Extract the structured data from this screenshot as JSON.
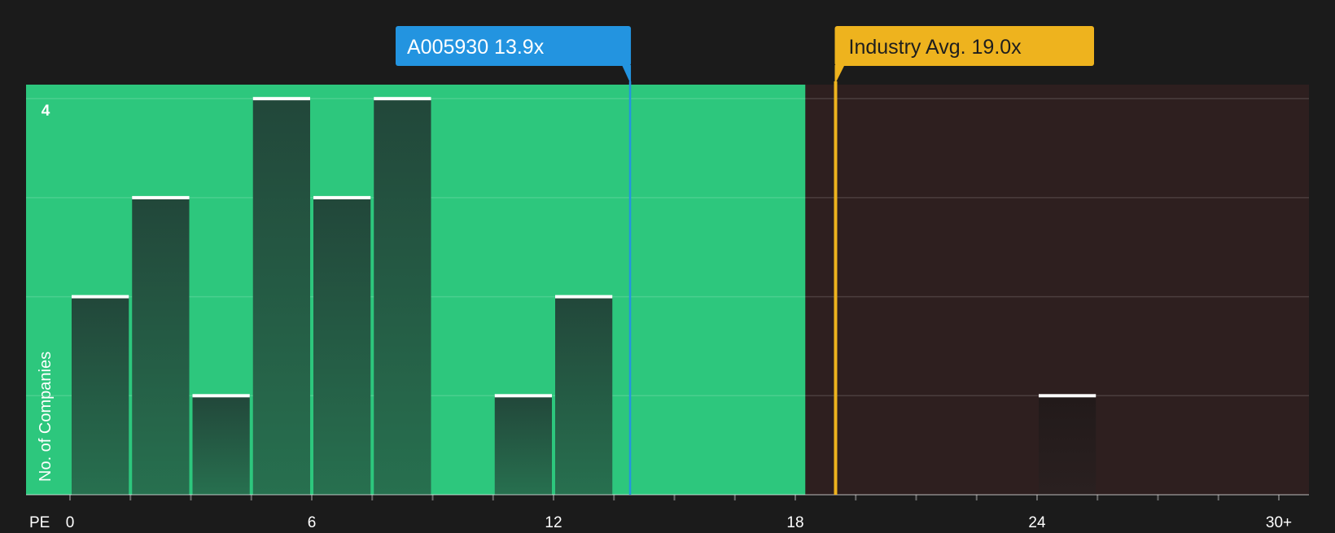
{
  "chart_data": {
    "type": "bar",
    "ylabel": "No. of Companies",
    "xlabel_prefix": "PE",
    "x_tick_labels": [
      "0",
      "6",
      "12",
      "18",
      "24",
      "30+"
    ],
    "y_tick_labels": [
      "4"
    ],
    "xlim": [
      0,
      30
    ],
    "ylim": [
      0,
      4
    ],
    "bins": [
      {
        "x0": 0,
        "x1": 1.5,
        "value": 2
      },
      {
        "x0": 1.5,
        "x1": 3,
        "value": 3
      },
      {
        "x0": 3,
        "x1": 4.5,
        "value": 1
      },
      {
        "x0": 4.5,
        "x1": 6,
        "value": 4
      },
      {
        "x0": 6,
        "x1": 7.5,
        "value": 3
      },
      {
        "x0": 7.5,
        "x1": 9,
        "value": 4
      },
      {
        "x0": 10.5,
        "x1": 12,
        "value": 1
      },
      {
        "x0": 12,
        "x1": 13.5,
        "value": 2
      },
      {
        "x0": 24,
        "x1": 25.5,
        "value": 1
      }
    ],
    "highlight_range": [
      0,
      18.25
    ],
    "company": {
      "label": "A005930 13.9x",
      "value": 13.9
    },
    "industry": {
      "label": "Industry Avg. 19.0x",
      "value": 19.0
    },
    "grid": true
  },
  "colors": {
    "background": "#1b1b1b",
    "good_zone": "#2dc77d",
    "bad_zone": "#2e1f1f",
    "bar": "#22473a",
    "bar_bad": "#231c1c",
    "bar_cap": "#ffffff",
    "company": "#2394e0",
    "industry": "#eeb31e",
    "text": "#ffffff"
  }
}
